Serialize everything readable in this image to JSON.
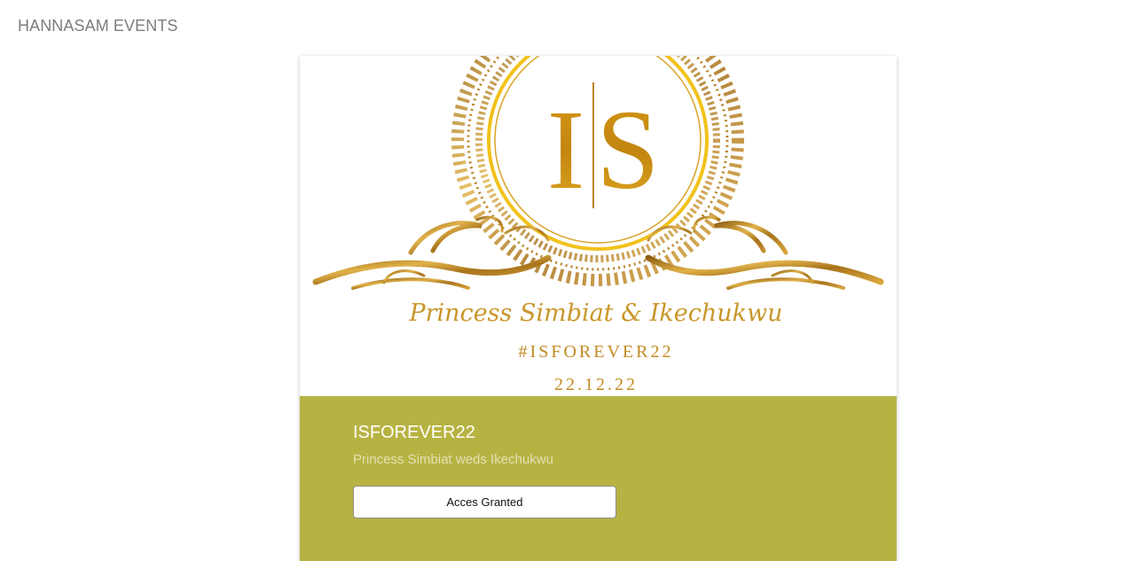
{
  "header": {
    "brand": "HANNASAM EVENTS"
  },
  "event": {
    "monogram_left": "I",
    "monogram_right": "S",
    "couple_script": "Princess Simbiat & Ikechukwu",
    "hashtag": "#ISFOREVER22",
    "date": "22.12.22",
    "title": "ISFOREVER22",
    "subtitle": "Princess Simbiat weds Ikechukwu",
    "access_button_label": "Acces Granted"
  },
  "colors": {
    "gold": "#c9962a",
    "gold_dark": "#9c6b18",
    "gold_bright": "#f2c21c",
    "info_panel": "#b7b343"
  }
}
